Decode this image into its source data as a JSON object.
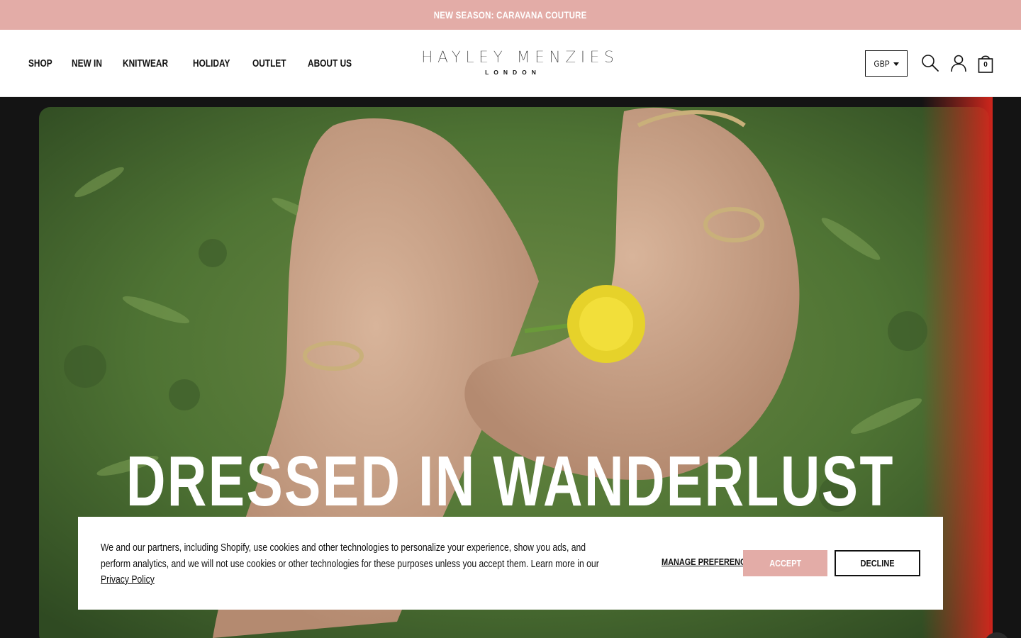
{
  "announcement": {
    "text": "NEW SEASON: CARAVANA COUTURE"
  },
  "nav": {
    "items": [
      {
        "label": "SHOP"
      },
      {
        "label": "NEW IN"
      },
      {
        "label": "KNITWEAR"
      },
      {
        "label": "HOLIDAY"
      },
      {
        "label": "OUTLET"
      },
      {
        "label": "ABOUT US"
      }
    ]
  },
  "logo": {
    "name": "HAYLEY MENZIES",
    "city": "LONDON"
  },
  "header": {
    "currency": "GBP",
    "cart_count": "0",
    "icons": [
      "search-icon",
      "account-icon",
      "cart-icon"
    ]
  },
  "hero": {
    "headline": "DRESSED IN WANDERLUST"
  },
  "cookie": {
    "text": "We and our partners, including Shopify, use cookies and other technologies to personalize your experience, show you ads, and perform analytics, and we will not use cookies or other technologies for these purposes unless you accept them. Learn more in our ",
    "link_text": "Privacy Policy",
    "manage_label": "MANAGE PREFERENCES",
    "accept_label": "ACCEPT",
    "decline_label": "DECLINE"
  },
  "colors": {
    "accent": "#e3aca7",
    "text": "#111111",
    "background": "#ffffff"
  }
}
